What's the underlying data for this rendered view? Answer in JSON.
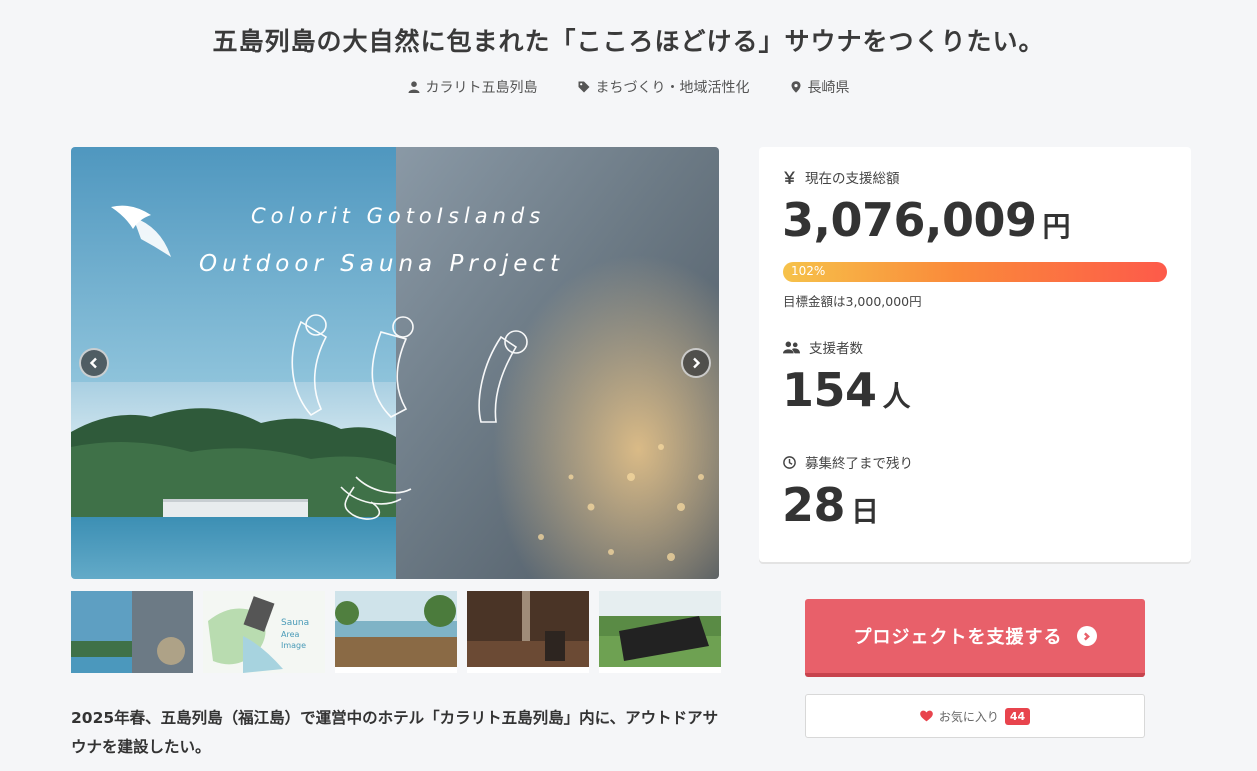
{
  "project": {
    "title": "五島列島の大自然に包まれた「こころほどける」サウナをつくりたい。",
    "owner": "カラリト五島列島",
    "category": "まちづくり・地域活性化",
    "location": "長崎県"
  },
  "hero": {
    "line1": "Colorit GotoIslands",
    "line2": "Outdoor Sauna Project"
  },
  "thumbnails": [
    {
      "name": "thumb-hero",
      "caption": ""
    },
    {
      "name": "thumb-sauna-area-map",
      "caption": "Sauna Area Image"
    },
    {
      "name": "thumb-outdoor-deck",
      "caption": ""
    },
    {
      "name": "thumb-sauna-interior",
      "caption": ""
    },
    {
      "name": "thumb-building-exterior",
      "caption": ""
    }
  ],
  "lead": "2025年春、五島列島（福江島）で運営中のホテル「カラリト五島列島」内に、アウトドアサウナを建設したい。",
  "stats": {
    "amount_label": "現在の支援総額",
    "amount": "3,076,009",
    "amount_unit": "円",
    "progress_label": "102%",
    "progress_percent": 102,
    "goal_text": "目標金額は3,000,000円",
    "supporters_label": "支援者数",
    "supporters": "154",
    "supporters_unit": "人",
    "remaining_label": "募集終了まで残り",
    "remaining": "28",
    "remaining_unit": "日"
  },
  "actions": {
    "support_label": "プロジェクトを支援する",
    "favorite_label": "お気に入り",
    "favorite_count": "44"
  },
  "colors": {
    "accent": "#e8606a",
    "heart": "#e8444d",
    "background": "#f5f6f8"
  }
}
